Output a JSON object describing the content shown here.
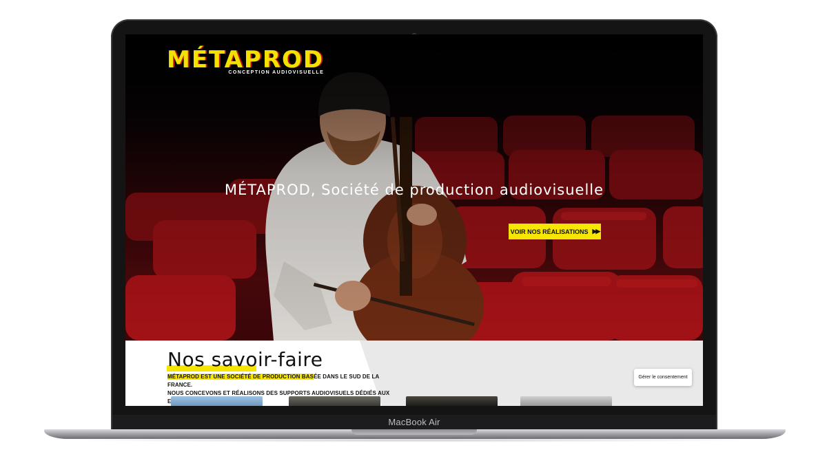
{
  "device": {
    "brand_label": "MacBook Air"
  },
  "site": {
    "logo": {
      "name": "MÉTAPROD",
      "tagline": "CONCEPTION AUDIOVISUELLE"
    },
    "hero": {
      "headline": "MÉTAPROD, Société de production audiovisuelle",
      "cta_label": "VOIR NOS RÉALISATIONS",
      "cta_icon": "fast-forward-icon"
    },
    "section": {
      "title": "Nos savoir-faire",
      "line1_highlight": "MÉTAPROD EST UNE SOCIÉTÉ DE PRODUCTION BAS",
      "line1_rest": "ÉE DANS LE SUD DE LA FRANCE.",
      "line2": "NOUS CONCEVONS ET RÉALISONS DES SUPPORTS AUDIOVISUELS DÉDIÉS AUX ENTREPRISES"
    },
    "consent": {
      "label": "Gérer le consentement"
    }
  },
  "colors": {
    "accent_yellow": "#f6e600",
    "logo_red": "#c0181d",
    "seat_red": "#8a0e12",
    "laptop_frame": "#141414"
  }
}
